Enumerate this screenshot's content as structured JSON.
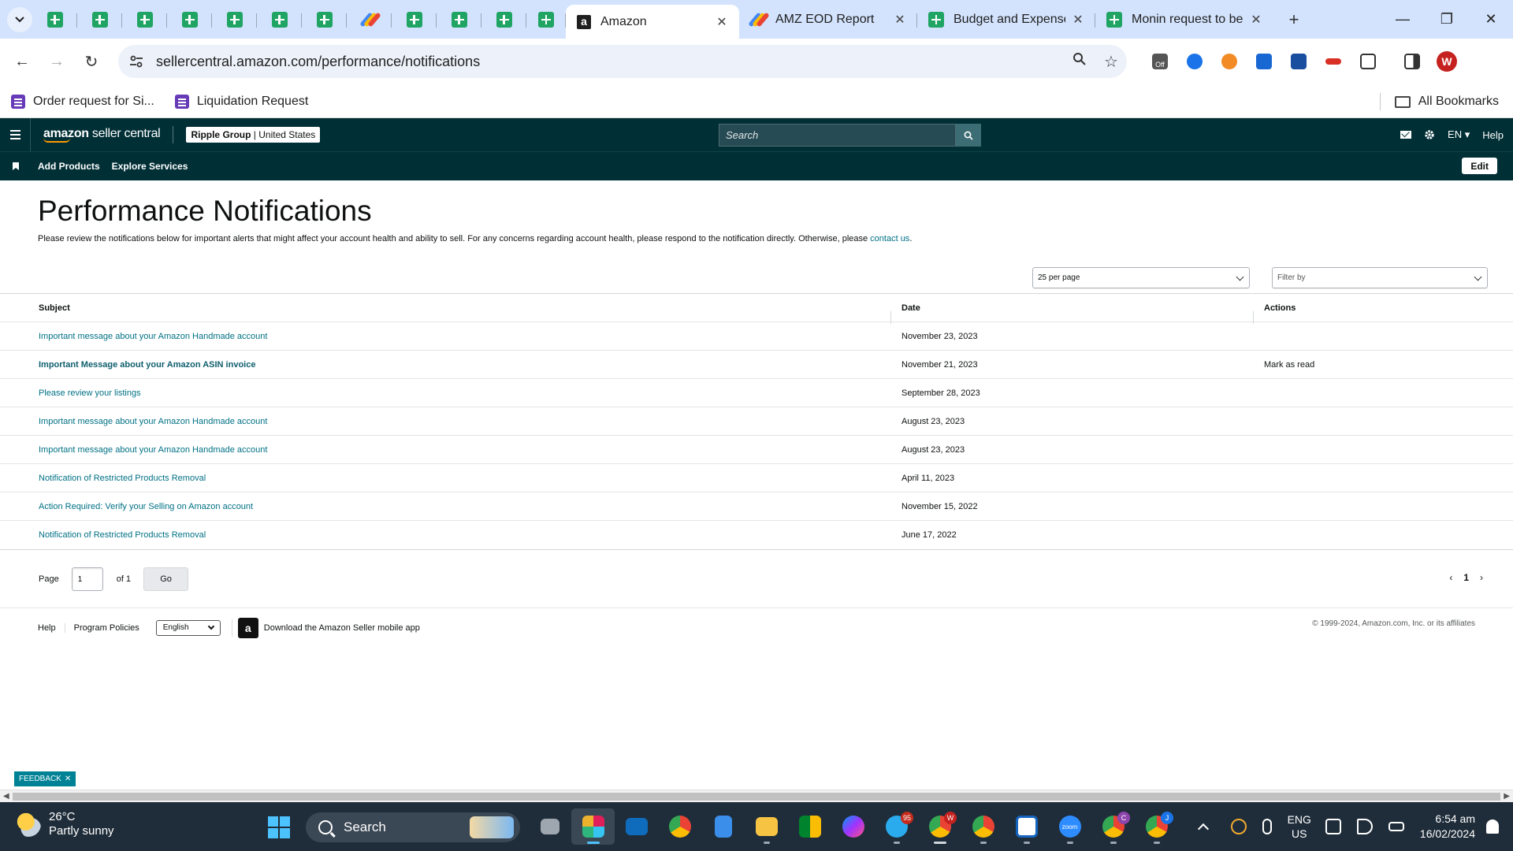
{
  "browser": {
    "tabs": [
      {
        "title": "Amazon",
        "active": true
      },
      {
        "title": "AMZ EOD Report",
        "active": false
      },
      {
        "title": "Budget and Expense",
        "active": false
      },
      {
        "title": "Monin request to be",
        "active": false
      }
    ],
    "url": "sellercentral.amazon.com/performance/notifications",
    "bookmarks": [
      "Order request for Si...",
      "Liquidation Request"
    ],
    "all_bookmarks": "All Bookmarks",
    "profile_initial": "W",
    "ext_off_label": "Off"
  },
  "seller_central": {
    "logo_strong": "amazon",
    "logo_thin": " seller central",
    "account_name": "Ripple Group",
    "account_region": " | United States",
    "search_placeholder": "Search",
    "lang": "EN",
    "help": "Help",
    "nav_links": [
      "Add Products",
      "Explore Services"
    ],
    "edit": "Edit"
  },
  "page": {
    "title": "Performance Notifications",
    "description": "Please review the notifications below for important alerts that might affect your account health and ability to sell. For any concerns regarding account health, please respond to the notification directly. Otherwise, please ",
    "contact_link": "contact us",
    "description_end": ".",
    "per_page": "25 per page",
    "filter_placeholder": "Filter by"
  },
  "table": {
    "headers": {
      "subject": "Subject",
      "date": "Date",
      "actions": "Actions"
    },
    "rows": [
      {
        "subject": "Important message about your Amazon Handmade account",
        "date": "November 23, 2023",
        "action": "",
        "unread": false
      },
      {
        "subject": "Important Message about your Amazon ASIN invoice",
        "date": "November 21, 2023",
        "action": "Mark as read",
        "unread": true
      },
      {
        "subject": "Please review your listings",
        "date": "September 28, 2023",
        "action": "",
        "unread": false
      },
      {
        "subject": "Important message about your Amazon Handmade account",
        "date": "August 23, 2023",
        "action": "",
        "unread": false
      },
      {
        "subject": "Important message about your Amazon Handmade account",
        "date": "August 23, 2023",
        "action": "",
        "unread": false
      },
      {
        "subject": "Notification of Restricted Products Removal",
        "date": "April 11, 2023",
        "action": "",
        "unread": false
      },
      {
        "subject": "Action Required: Verify your Selling on Amazon account",
        "date": "November 15, 2022",
        "action": "",
        "unread": false
      },
      {
        "subject": "Notification of Restricted Products Removal",
        "date": "June 17, 2022",
        "action": "",
        "unread": false
      }
    ]
  },
  "pager": {
    "label": "Page",
    "current": "1",
    "of": "of 1",
    "go": "Go",
    "nav_page": "1"
  },
  "footer": {
    "help": "Help",
    "policies": "Program Policies",
    "language": "English",
    "app_text": "Download the Amazon Seller mobile app",
    "copyright": "© 1999-2024, Amazon.com, Inc. or its affiliates"
  },
  "feedback": "FEEDBACK",
  "taskbar": {
    "temp": "26°C",
    "weather": "Partly sunny",
    "search": "Search",
    "telegram_badge": "95",
    "chrome_badge_w": "W",
    "chrome_badge_c": "C",
    "chrome_badge_j": "J",
    "zoom_label": "zoom",
    "lang_top": "ENG",
    "lang_bottom": "US",
    "time": "6:54 am",
    "date": "16/02/2024"
  }
}
